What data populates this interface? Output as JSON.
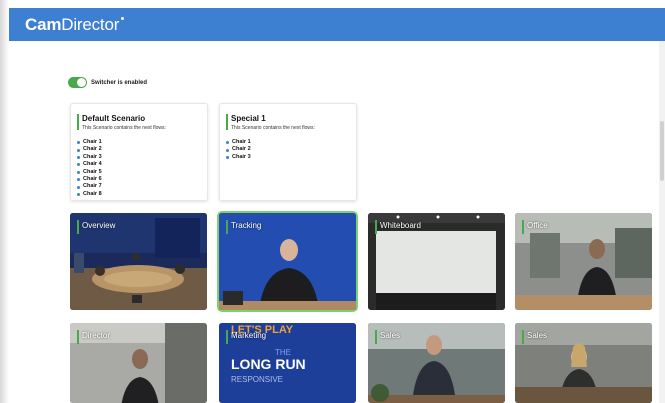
{
  "app": {
    "logo_bold": "Cam",
    "logo_light": "Director"
  },
  "switcher": {
    "label": "Switcher is enabled",
    "enabled": true,
    "color": "#48a84e"
  },
  "scenarios": [
    {
      "title": "Default Scenario",
      "subtitle": "This Scenario contains the next flows:",
      "items": [
        "Chair 1",
        "Chair 2",
        "Chair 3",
        "Chair 4",
        "Chair 5",
        "Chair 6",
        "Chair 7",
        "Chair 8"
      ]
    },
    {
      "title": "Special 1",
      "subtitle": "This Scenario contains the next flows:",
      "items": [
        "Chair 1",
        "Chair 2",
        "Chair 3"
      ]
    }
  ],
  "cameras": [
    {
      "label": "Overview",
      "selected": false
    },
    {
      "label": "Tracking",
      "selected": true
    },
    {
      "label": "Whiteboard",
      "selected": false
    },
    {
      "label": "Office",
      "selected": false
    },
    {
      "label": "Director",
      "selected": false
    },
    {
      "label": "Marketing",
      "selected": false,
      "overlay_lines": [
        "LET'S PLAY",
        "THE",
        "LONG RUN",
        "RESPONSIVE"
      ]
    },
    {
      "label": "Sales",
      "selected": false
    },
    {
      "label": "Sales",
      "selected": false
    }
  ],
  "colors": {
    "header": "#3d7fd1",
    "accent": "#48a84e",
    "selected_border": "#7bd36b"
  }
}
